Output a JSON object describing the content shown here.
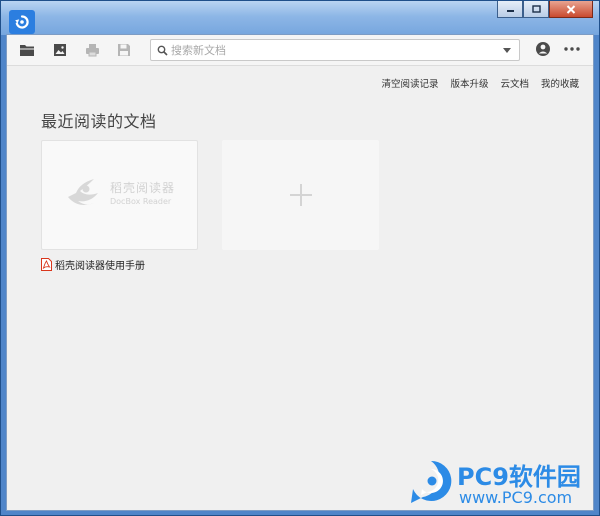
{
  "toolbar": {
    "search_placeholder": "搜索新文档"
  },
  "top_links": [
    "清空阅读记录",
    "版本升级",
    "云文档",
    "我的收藏"
  ],
  "main": {
    "section_title": "最近阅读的文档",
    "recent_docs": [
      {
        "thumbnail_brand": "稻壳阅读器",
        "thumbnail_brand_en": "DocBox Reader",
        "name": "稻壳阅读器使用手册",
        "icon": "pdf-icon"
      }
    ],
    "add_card_icon": "plus-icon"
  },
  "watermark": {
    "brand": "PC9软件园",
    "url": "www.PC9.com"
  },
  "colors": {
    "titlebar": "#8db6e6",
    "app_icon": "#2b7ee0",
    "pdf_red": "#d9361c",
    "watermark_blue": "#2c8be6"
  }
}
